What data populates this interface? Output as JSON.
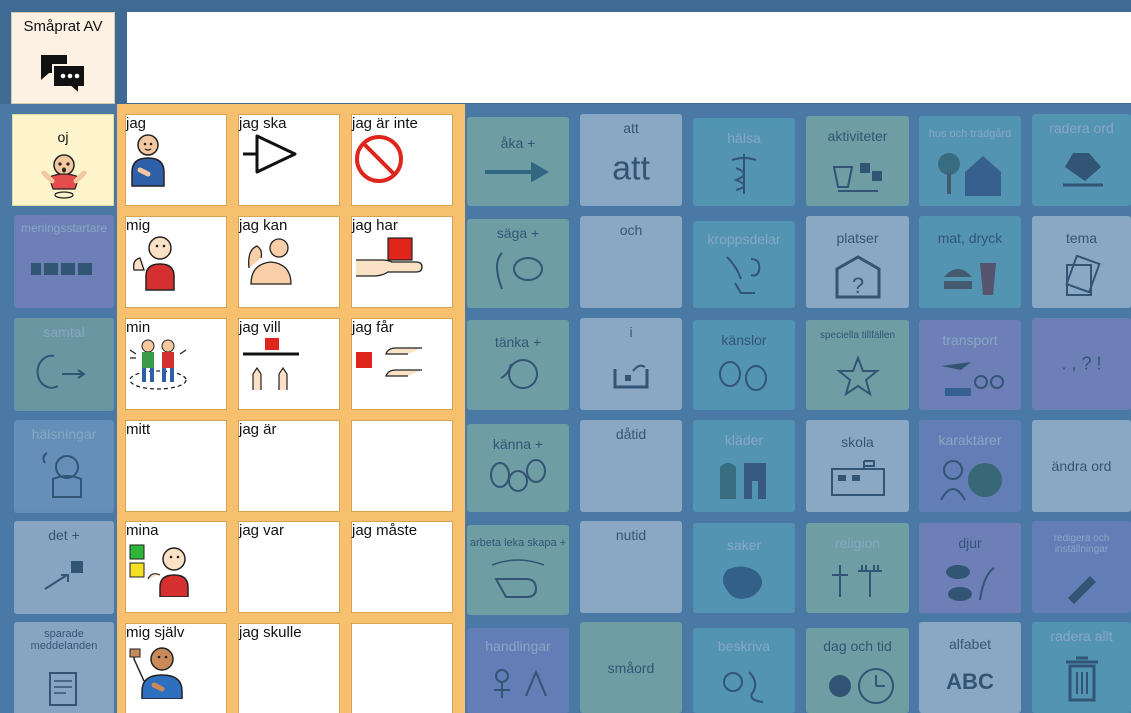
{
  "header": {
    "speech_button_label": "Småprat AV",
    "message_text": ""
  },
  "sidebar": {
    "items": [
      {
        "label": "oj",
        "icon": "surprised-person-icon"
      },
      {
        "label": "meningsstartare",
        "icon": "sentence-blocks-icon"
      },
      {
        "label": "samtal",
        "icon": "talking-head-icon"
      },
      {
        "label": "hälsningar",
        "icon": "waving-person-icon"
      },
      {
        "label": "det +",
        "icon": "arrow-to-square-icon"
      },
      {
        "label": "sparade meddelanden",
        "icon": "notepad-icon"
      }
    ]
  },
  "phrases": {
    "cells": [
      {
        "label": "jag",
        "icon": "person-pointing-self-icon"
      },
      {
        "label": "jag ska",
        "icon": "triangle-arrow-icon"
      },
      {
        "label": "jag är inte",
        "icon": "prohibited-icon"
      },
      {
        "label": "mig",
        "icon": "person-thumb-self-icon"
      },
      {
        "label": "jag kan",
        "icon": "strong-arm-icon"
      },
      {
        "label": "jag har",
        "icon": "hand-holding-box-icon"
      },
      {
        "label": "min",
        "icon": "two-people-circle-icon"
      },
      {
        "label": "jag vill",
        "icon": "hands-reaching-icon"
      },
      {
        "label": "jag får",
        "icon": "hands-receiving-icon"
      },
      {
        "label": "mitt",
        "icon": ""
      },
      {
        "label": "jag är",
        "icon": ""
      },
      {
        "label": "",
        "icon": ""
      },
      {
        "label": "mina",
        "icon": "person-with-squares-icon"
      },
      {
        "label": "jag var",
        "icon": ""
      },
      {
        "label": "jag måste",
        "icon": ""
      },
      {
        "label": "mig själv",
        "icon": "person-waving-icon"
      },
      {
        "label": "jag skulle",
        "icon": ""
      },
      {
        "label": "",
        "icon": ""
      }
    ]
  },
  "grid": {
    "col1": [
      {
        "label": "åka +"
      },
      {
        "label": "säga +"
      },
      {
        "label": "tänka +"
      },
      {
        "label": "känna +"
      },
      {
        "label": "arbeta leka skapa +"
      },
      {
        "label": "handlingar"
      }
    ],
    "col2": [
      {
        "label": "att",
        "big": "att"
      },
      {
        "label": "och"
      },
      {
        "label": "i"
      },
      {
        "label": "dåtid"
      },
      {
        "label": "nutid"
      },
      {
        "label": "småord"
      }
    ],
    "col3": [
      {
        "label": "hälsa"
      },
      {
        "label": "kroppsdelar"
      },
      {
        "label": "känslor"
      },
      {
        "label": "kläder"
      },
      {
        "label": "saker"
      },
      {
        "label": "beskriva"
      }
    ],
    "col4": [
      {
        "label": "aktiviteter"
      },
      {
        "label": "platser"
      },
      {
        "label": "speciella tillfällen"
      },
      {
        "label": "skola"
      },
      {
        "label": "religion"
      },
      {
        "label": "dag och tid"
      }
    ],
    "col5": [
      {
        "label": "hus och trädgård"
      },
      {
        "label": "mat, dryck"
      },
      {
        "label": "transport"
      },
      {
        "label": "karaktärer"
      },
      {
        "label": "djur"
      },
      {
        "label": "alfabet",
        "big": "ABC"
      }
    ],
    "col6": [
      {
        "label": "radera ord"
      },
      {
        "label": "tema"
      },
      {
        "label": "",
        "big": ". , ? !"
      },
      {
        "label": "ändra ord"
      },
      {
        "label": "redigera och inställningar"
      },
      {
        "label": "radera allt"
      }
    ]
  },
  "colors": {
    "dim_overlay": "#4b79a5",
    "panel_orange": "#f7c06e",
    "folder_green": "#a8d9a0",
    "folder_purple": "#8a86d6",
    "folder_teal": "#5ec2c8"
  }
}
